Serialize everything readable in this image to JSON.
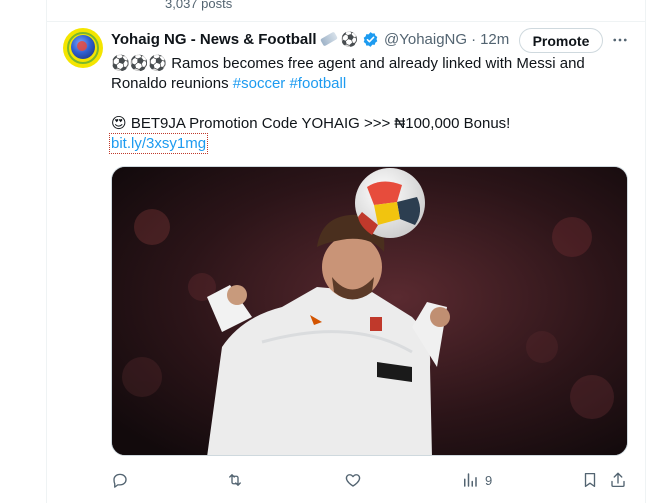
{
  "previous_post": {
    "posts_count": "3,037 posts"
  },
  "tweet": {
    "author_name": "Yohaig NG - News & Football",
    "handle": "@YohaigNG",
    "separator": "·",
    "time": "12m",
    "promote_label": "Promote",
    "text_line1": "Ramos becomes free agent and already linked with Messi and Ronaldo reunions",
    "hashtags": [
      "#soccer",
      "#football"
    ],
    "lead_emojis": "⚽⚽⚽",
    "promo_emoji": "😍",
    "promo_text": "BET9JA Promotion Code YOHAIG >>> ₦100,000 Bonus!",
    "link": "bit.ly/3xsy1mg",
    "views_count": "9"
  },
  "icons": {
    "verified": "verified-badge-icon",
    "more": "more-dots-icon",
    "reply": "reply-icon",
    "retweet": "retweet-icon",
    "like": "like-icon",
    "views": "views-icon",
    "bookmark": "bookmark-icon",
    "share": "share-icon"
  },
  "colors": {
    "accent": "#1d9bf0",
    "secondary_text": "#536471",
    "border": "#eff3f4"
  }
}
